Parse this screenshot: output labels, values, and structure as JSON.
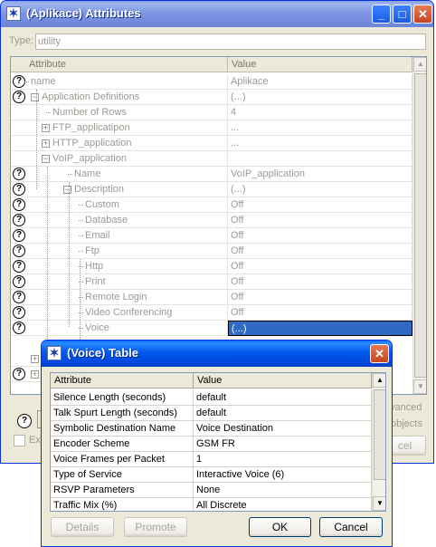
{
  "attr_window": {
    "title": "(Aplikace) Attributes",
    "type_label": "Type:",
    "type_value": "utility",
    "header_attribute": "Attribute",
    "header_value": "Value",
    "rows": [
      {
        "name": "name",
        "value": "Aplikace"
      },
      {
        "name": "Application Definitions",
        "value": "(...)"
      },
      {
        "name": "Number of Rows",
        "value": "4"
      },
      {
        "name": "FTP_applicatipon",
        "value": "..."
      },
      {
        "name": "HTTP_application",
        "value": "..."
      },
      {
        "name": "VoIP_application",
        "value": ""
      },
      {
        "name": "Name",
        "value": "VoIP_application"
      },
      {
        "name": "Description",
        "value": "(...)"
      },
      {
        "name": "Custom",
        "value": "Off"
      },
      {
        "name": "Database",
        "value": "Off"
      },
      {
        "name": "Email",
        "value": "Off"
      },
      {
        "name": "Ftp",
        "value": "Off"
      },
      {
        "name": "Http",
        "value": "Off"
      },
      {
        "name": "Print",
        "value": "Off"
      },
      {
        "name": "Remote Login",
        "value": "Off"
      },
      {
        "name": "Video Conferencing",
        "value": "Off"
      },
      {
        "name": "Voice",
        "value": "(...)"
      }
    ],
    "advanced_label": "vanced",
    "objects_label": "objects",
    "exact_label": "Ex",
    "cancel_fragment": "cel"
  },
  "voice_window": {
    "title": "(Voice) Table",
    "header_attribute": "Attribute",
    "header_value": "Value",
    "rows": [
      {
        "name": "Silence Length (seconds)",
        "value": "default"
      },
      {
        "name": "Talk Spurt Length (seconds)",
        "value": "default"
      },
      {
        "name": "Symbolic Destination Name",
        "value": "Voice Destination"
      },
      {
        "name": "Encoder Scheme",
        "value": "GSM FR"
      },
      {
        "name": "Voice Frames per Packet",
        "value": "1"
      },
      {
        "name": "Type of Service",
        "value": "Interactive Voice (6)"
      },
      {
        "name": "RSVP Parameters",
        "value": "None"
      },
      {
        "name": "Traffic Mix (%)",
        "value": "All Discrete"
      }
    ],
    "buttons": {
      "details": "Details",
      "promote": "Promote",
      "ok": "OK",
      "cancel": "Cancel"
    }
  },
  "icons": {
    "app": "opnet-star-icon",
    "help": "question-icon",
    "minimize": "minimize-icon",
    "maximize": "maximize-icon",
    "close": "close-icon"
  }
}
